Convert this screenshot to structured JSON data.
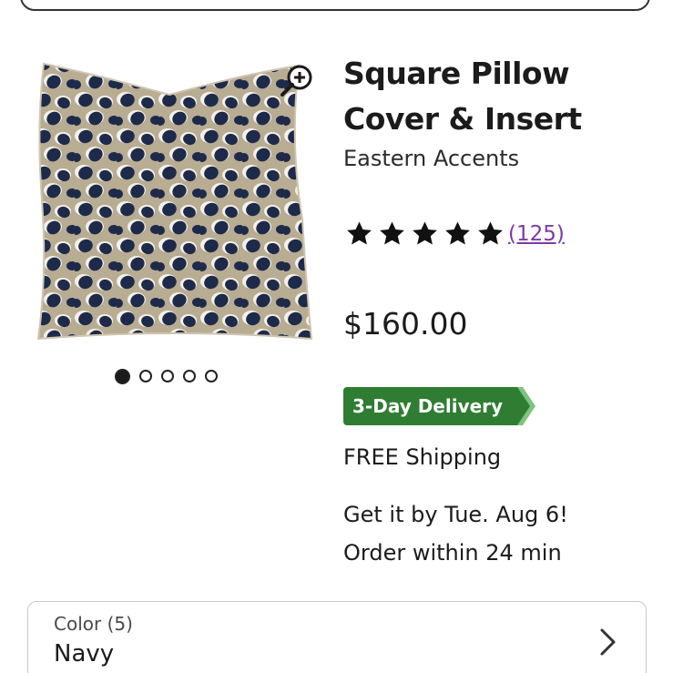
{
  "product": {
    "title_line1": "Square Pillow",
    "title_line2": "Cover & Insert",
    "brand": "Eastern Accents",
    "rating": 5,
    "review_count": "(125)",
    "price": "$160.00",
    "delivery_badge": "3-Day Delivery",
    "shipping": "FREE Shipping",
    "eta_line1": "Get it by Tue. Aug 6!",
    "eta_line2": "Order within 24 min"
  },
  "gallery": {
    "image_count": 5,
    "active_index": 0,
    "zoom_icon": "zoom-in-icon"
  },
  "color_selector": {
    "label": "Color (5)",
    "value": "Navy",
    "chevron_icon": "chevron-right-icon"
  },
  "colors": {
    "badge_green": "#2f7d32",
    "link_purple": "#7b3aa7",
    "pillow_base": "#b8ac92",
    "pillow_spot": "#1e2a4a"
  }
}
